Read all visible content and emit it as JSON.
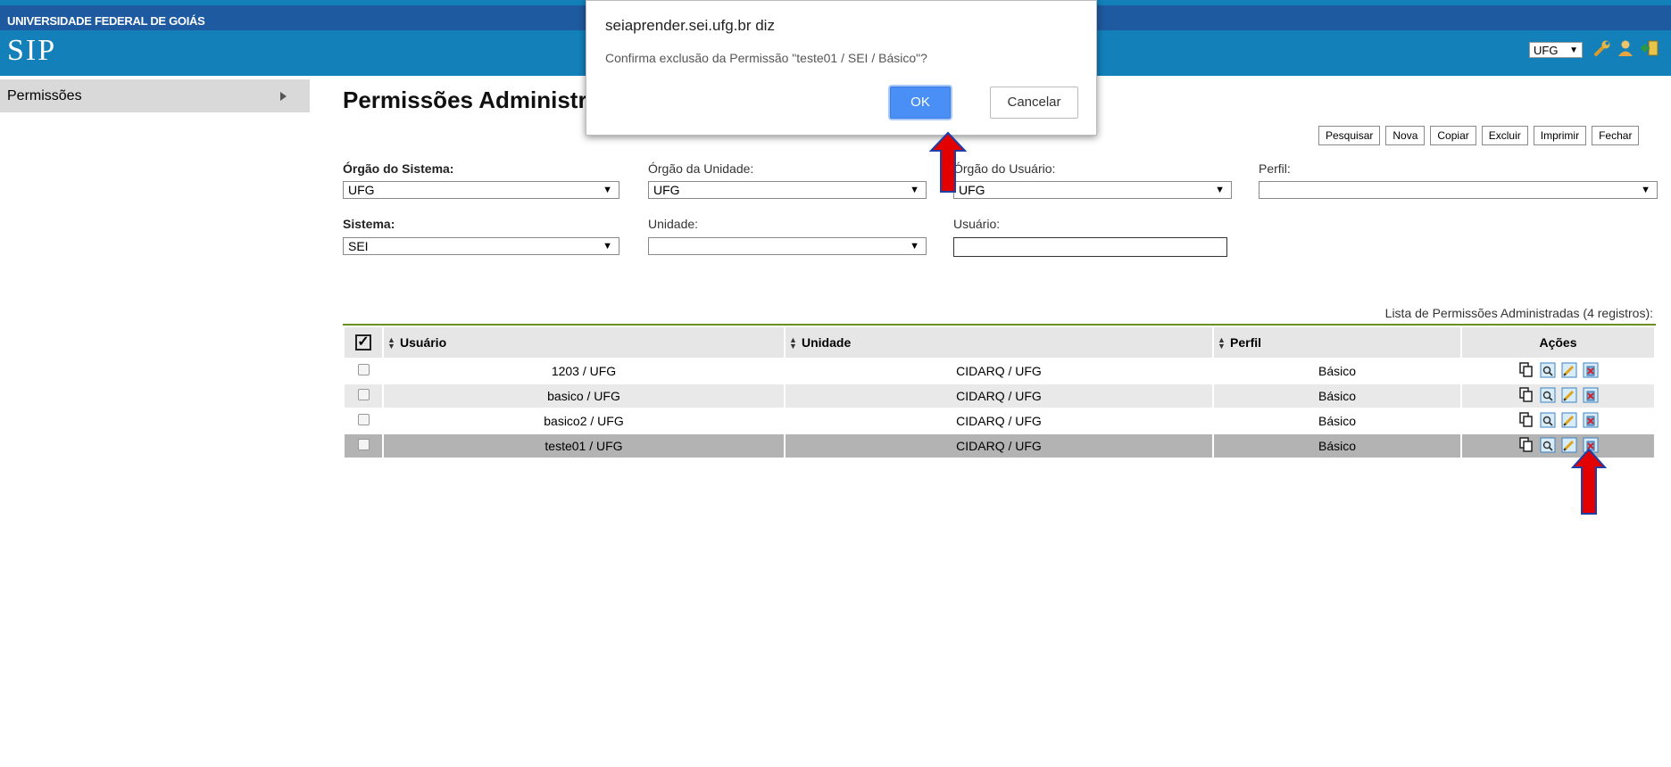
{
  "header": {
    "university": "UNIVERSIDADE FEDERAL DE GOIÁS",
    "logo": "SIP",
    "org_select": "UFG"
  },
  "sidebar": {
    "items": [
      {
        "label": "Permissões"
      }
    ]
  },
  "main": {
    "title": "Permissões Administra",
    "buttons": [
      "Pesquisar",
      "Nova",
      "Copiar",
      "Excluir",
      "Imprimir",
      "Fechar"
    ],
    "filters": {
      "orgao_sistema": {
        "label": "Órgão do Sistema:",
        "value": "UFG"
      },
      "orgao_unidade": {
        "label": "Órgão da Unidade:",
        "value": "UFG"
      },
      "orgao_usuario": {
        "label": "Órgão do Usuário:",
        "value": "UFG"
      },
      "perfil": {
        "label": "Perfil:",
        "value": ""
      },
      "sistema": {
        "label": "Sistema:",
        "value": "SEI"
      },
      "unidade": {
        "label": "Unidade:",
        "value": ""
      },
      "usuario": {
        "label": "Usuário:",
        "value": ""
      }
    },
    "table": {
      "caption": "Lista de Permissões Administradas (4 registros):",
      "headers": {
        "usuario": "Usuário",
        "unidade": "Unidade",
        "perfil": "Perfil",
        "acoes": "Ações"
      },
      "rows": [
        {
          "usuario": "1203 / UFG",
          "unidade": "CIDARQ / UFG",
          "perfil": "Básico"
        },
        {
          "usuario": "basico / UFG",
          "unidade": "CIDARQ / UFG",
          "perfil": "Básico"
        },
        {
          "usuario": "basico2 / UFG",
          "unidade": "CIDARQ / UFG",
          "perfil": "Básico"
        },
        {
          "usuario": "teste01 / UFG",
          "unidade": "CIDARQ / UFG",
          "perfil": "Básico"
        }
      ]
    }
  },
  "dialog": {
    "title": "seiaprender.sei.ufg.br diz",
    "message": "Confirma exclusão da Permissão \"teste01 / SEI / Básico\"?",
    "ok": "OK",
    "cancel": "Cancelar"
  },
  "colors": {
    "header_blue": "#1380ba",
    "header_stripe": "#1e5aa0",
    "ok_button": "#4a8ff6",
    "arrow_red": "#e30000",
    "arrow_outline": "#1d3fa8"
  },
  "icons": [
    "wrench-icon",
    "user-icon",
    "exit-icon",
    "copy-icon",
    "view-icon",
    "edit-icon",
    "delete-icon"
  ]
}
